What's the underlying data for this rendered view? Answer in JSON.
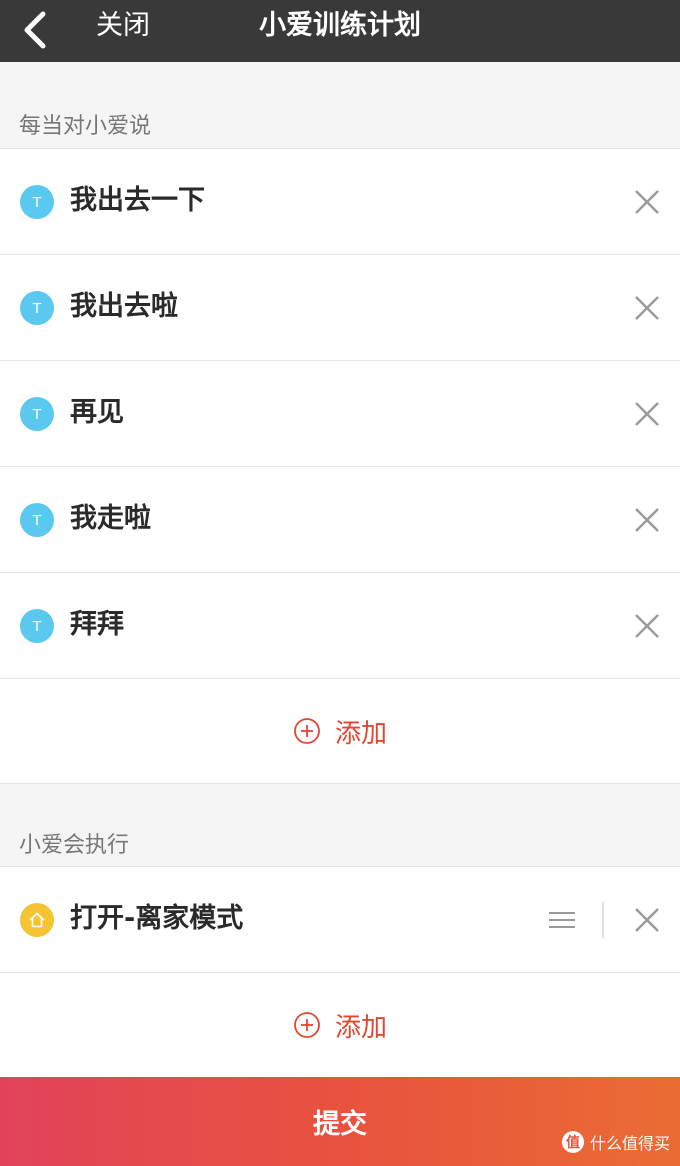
{
  "nav": {
    "back_icon": "chevron-left-icon",
    "close_label": "关闭",
    "title": "小爱训练计划"
  },
  "trigger": {
    "label": "每当对小爱说",
    "items": [
      {
        "badge": "T",
        "text": "我出去一下"
      },
      {
        "badge": "T",
        "text": "我出去啦"
      },
      {
        "badge": "T",
        "text": "再见"
      },
      {
        "badge": "T",
        "text": "我走啦"
      },
      {
        "badge": "T",
        "text": "拜拜"
      }
    ],
    "add_label": "添加"
  },
  "action": {
    "label": "小爱会执行",
    "items": [
      {
        "icon": "home-icon",
        "text": "打开-离家模式"
      }
    ],
    "add_label": "添加"
  },
  "submit_label": "提交",
  "watermark": {
    "text": "什么值得买",
    "icon_text": "值"
  },
  "colors": {
    "nav_bg": "#393939",
    "accent": "#e4462f",
    "badge_blue": "#5bc8ef",
    "badge_yellow": "#f4c433"
  }
}
